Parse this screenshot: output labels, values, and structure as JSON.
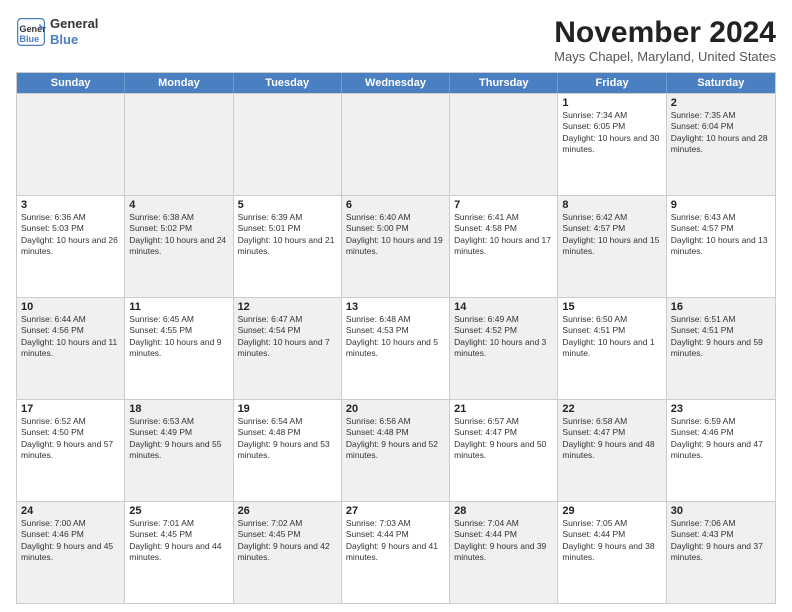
{
  "header": {
    "logo_line1": "General",
    "logo_line2": "Blue",
    "month": "November 2024",
    "location": "Mays Chapel, Maryland, United States"
  },
  "weekdays": [
    "Sunday",
    "Monday",
    "Tuesday",
    "Wednesday",
    "Thursday",
    "Friday",
    "Saturday"
  ],
  "rows": [
    [
      {
        "day": "",
        "info": "",
        "shaded": true
      },
      {
        "day": "",
        "info": "",
        "shaded": true
      },
      {
        "day": "",
        "info": "",
        "shaded": true
      },
      {
        "day": "",
        "info": "",
        "shaded": true
      },
      {
        "day": "",
        "info": "",
        "shaded": true
      },
      {
        "day": "1",
        "info": "Sunrise: 7:34 AM\nSunset: 6:05 PM\nDaylight: 10 hours and 30 minutes."
      },
      {
        "day": "2",
        "info": "Sunrise: 7:35 AM\nSunset: 6:04 PM\nDaylight: 10 hours and 28 minutes.",
        "shaded": true
      }
    ],
    [
      {
        "day": "3",
        "info": "Sunrise: 6:36 AM\nSunset: 5:03 PM\nDaylight: 10 hours and 26 minutes."
      },
      {
        "day": "4",
        "info": "Sunrise: 6:38 AM\nSunset: 5:02 PM\nDaylight: 10 hours and 24 minutes.",
        "shaded": true
      },
      {
        "day": "5",
        "info": "Sunrise: 6:39 AM\nSunset: 5:01 PM\nDaylight: 10 hours and 21 minutes."
      },
      {
        "day": "6",
        "info": "Sunrise: 6:40 AM\nSunset: 5:00 PM\nDaylight: 10 hours and 19 minutes.",
        "shaded": true
      },
      {
        "day": "7",
        "info": "Sunrise: 6:41 AM\nSunset: 4:58 PM\nDaylight: 10 hours and 17 minutes."
      },
      {
        "day": "8",
        "info": "Sunrise: 6:42 AM\nSunset: 4:57 PM\nDaylight: 10 hours and 15 minutes.",
        "shaded": true
      },
      {
        "day": "9",
        "info": "Sunrise: 6:43 AM\nSunset: 4:57 PM\nDaylight: 10 hours and 13 minutes."
      }
    ],
    [
      {
        "day": "10",
        "info": "Sunrise: 6:44 AM\nSunset: 4:56 PM\nDaylight: 10 hours and 11 minutes.",
        "shaded": true
      },
      {
        "day": "11",
        "info": "Sunrise: 6:45 AM\nSunset: 4:55 PM\nDaylight: 10 hours and 9 minutes."
      },
      {
        "day": "12",
        "info": "Sunrise: 6:47 AM\nSunset: 4:54 PM\nDaylight: 10 hours and 7 minutes.",
        "shaded": true
      },
      {
        "day": "13",
        "info": "Sunrise: 6:48 AM\nSunset: 4:53 PM\nDaylight: 10 hours and 5 minutes."
      },
      {
        "day": "14",
        "info": "Sunrise: 6:49 AM\nSunset: 4:52 PM\nDaylight: 10 hours and 3 minutes.",
        "shaded": true
      },
      {
        "day": "15",
        "info": "Sunrise: 6:50 AM\nSunset: 4:51 PM\nDaylight: 10 hours and 1 minute."
      },
      {
        "day": "16",
        "info": "Sunrise: 6:51 AM\nSunset: 4:51 PM\nDaylight: 9 hours and 59 minutes.",
        "shaded": true
      }
    ],
    [
      {
        "day": "17",
        "info": "Sunrise: 6:52 AM\nSunset: 4:50 PM\nDaylight: 9 hours and 57 minutes."
      },
      {
        "day": "18",
        "info": "Sunrise: 6:53 AM\nSunset: 4:49 PM\nDaylight: 9 hours and 55 minutes.",
        "shaded": true
      },
      {
        "day": "19",
        "info": "Sunrise: 6:54 AM\nSunset: 4:48 PM\nDaylight: 9 hours and 53 minutes."
      },
      {
        "day": "20",
        "info": "Sunrise: 6:56 AM\nSunset: 4:48 PM\nDaylight: 9 hours and 52 minutes.",
        "shaded": true
      },
      {
        "day": "21",
        "info": "Sunrise: 6:57 AM\nSunset: 4:47 PM\nDaylight: 9 hours and 50 minutes."
      },
      {
        "day": "22",
        "info": "Sunrise: 6:58 AM\nSunset: 4:47 PM\nDaylight: 9 hours and 48 minutes.",
        "shaded": true
      },
      {
        "day": "23",
        "info": "Sunrise: 6:59 AM\nSunset: 4:46 PM\nDaylight: 9 hours and 47 minutes."
      }
    ],
    [
      {
        "day": "24",
        "info": "Sunrise: 7:00 AM\nSunset: 4:46 PM\nDaylight: 9 hours and 45 minutes.",
        "shaded": true
      },
      {
        "day": "25",
        "info": "Sunrise: 7:01 AM\nSunset: 4:45 PM\nDaylight: 9 hours and 44 minutes."
      },
      {
        "day": "26",
        "info": "Sunrise: 7:02 AM\nSunset: 4:45 PM\nDaylight: 9 hours and 42 minutes.",
        "shaded": true
      },
      {
        "day": "27",
        "info": "Sunrise: 7:03 AM\nSunset: 4:44 PM\nDaylight: 9 hours and 41 minutes."
      },
      {
        "day": "28",
        "info": "Sunrise: 7:04 AM\nSunset: 4:44 PM\nDaylight: 9 hours and 39 minutes.",
        "shaded": true
      },
      {
        "day": "29",
        "info": "Sunrise: 7:05 AM\nSunset: 4:44 PM\nDaylight: 9 hours and 38 minutes."
      },
      {
        "day": "30",
        "info": "Sunrise: 7:06 AM\nSunset: 4:43 PM\nDaylight: 9 hours and 37 minutes.",
        "shaded": true
      }
    ]
  ]
}
